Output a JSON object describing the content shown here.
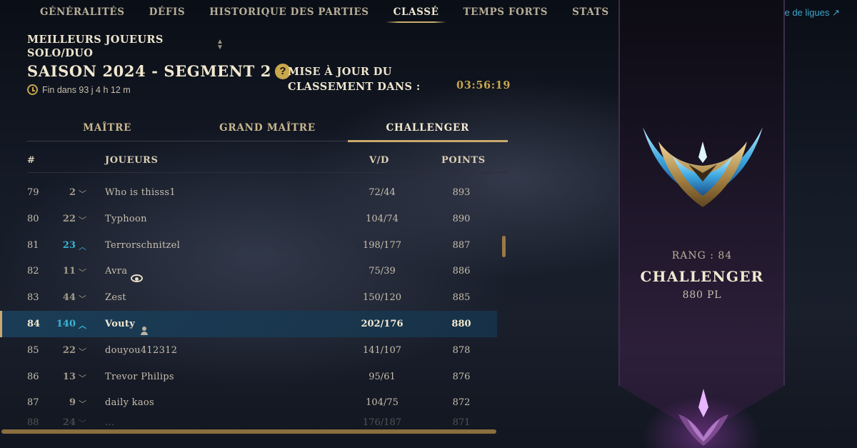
{
  "nav": {
    "tabs": [
      "GÉNÉRALITÉS",
      "DÉFIS",
      "HISTORIQUE DES PARTIES",
      "CLASSÉ",
      "TEMPS FORTS",
      "STATS"
    ],
    "active": "CLASSÉ",
    "faq_label": "FAQ du système de ligues ↗"
  },
  "header": {
    "queue_line1": "MEILLEURS JOUEURS",
    "queue_line2": "SOLO/DUO",
    "season": "SAISON 2024 - SEGMENT 2",
    "help_label": "?",
    "ends_in": "Fin dans 93 j 4 h 12 m",
    "update_line1": "MISE À JOUR DU",
    "update_line2": "CLASSEMENT DANS :",
    "timer": "03:56:19"
  },
  "tiers": {
    "items": [
      "MAÎTRE",
      "GRAND MAÎTRE",
      "CHALLENGER"
    ],
    "active": "CHALLENGER"
  },
  "table": {
    "headers": {
      "rank": "#",
      "players": "JOUEURS",
      "wl": "V/D",
      "points": "POINTS"
    },
    "rows": [
      {
        "rank": "79",
        "change": "2",
        "dir": "down",
        "name": "Who is thisss1",
        "wl": "72/44",
        "points": "893"
      },
      {
        "rank": "80",
        "change": "22",
        "dir": "down",
        "name": "Typhoon",
        "wl": "104/74",
        "points": "890"
      },
      {
        "rank": "81",
        "change": "23",
        "dir": "up",
        "name": "Terrorschnitzel",
        "wl": "198/177",
        "points": "887"
      },
      {
        "rank": "82",
        "change": "11",
        "dir": "down",
        "name": "Avra",
        "wl": "75/39",
        "points": "886",
        "icon": "eye-icon"
      },
      {
        "rank": "83",
        "change": "44",
        "dir": "down",
        "name": "Zest",
        "wl": "150/120",
        "points": "885"
      },
      {
        "rank": "84",
        "change": "140",
        "dir": "up",
        "name": "Vouty",
        "wl": "202/176",
        "points": "880",
        "icon": "person-icon",
        "current": true
      },
      {
        "rank": "85",
        "change": "22",
        "dir": "down",
        "name": "douyou412312",
        "wl": "141/107",
        "points": "878"
      },
      {
        "rank": "86",
        "change": "13",
        "dir": "down",
        "name": "Trevor Philips",
        "wl": "95/61",
        "points": "876"
      },
      {
        "rank": "87",
        "change": "9",
        "dir": "down",
        "name": "daily kaos",
        "wl": "104/75",
        "points": "872"
      },
      {
        "rank": "88",
        "change": "24",
        "dir": "down",
        "name": "...",
        "wl": "176/187",
        "points": "871",
        "partial": true
      }
    ]
  },
  "banner": {
    "rank_label": "RANG : 84",
    "tier": "CHALLENGER",
    "lp": "880 PL"
  },
  "colors": {
    "gold": "#c8aa6e",
    "up": "#3ab4d6",
    "link": "#3ea6c9"
  }
}
